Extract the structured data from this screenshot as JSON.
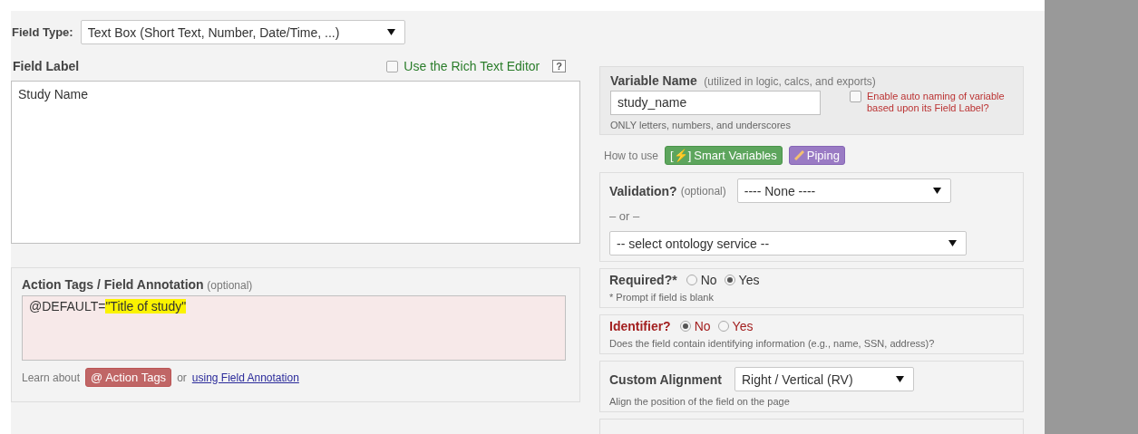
{
  "field_type": {
    "label": "Field Type:",
    "value": "Text Box (Short Text, Number, Date/Time, ...)"
  },
  "field_label": {
    "label": "Field Label",
    "rich_text": {
      "label": "Use the Rich Text Editor",
      "checked": false
    },
    "help": "?",
    "value": "Study Name"
  },
  "annotation": {
    "label": "Action Tags / Field Annotation",
    "hint": "(optional)",
    "value": "@DEFAULT=",
    "highlighted": "\"Title of study\"",
    "learn": "Learn about",
    "tags_button": "@ Action Tags",
    "or": "or",
    "link": "using Field Annotation"
  },
  "variable": {
    "label": "Variable Name",
    "hint": "(utilized in logic, calcs, and exports)",
    "value": "study_name",
    "note": "ONLY letters, numbers, and underscores",
    "auto_naming": {
      "label": "Enable auto naming of variable based upon its Field Label?",
      "checked": false
    }
  },
  "how_to_use": {
    "label": "How to use",
    "buttons": [
      {
        "kind": "smart",
        "icon": "[⚡]",
        "label": "Smart Variables"
      },
      {
        "kind": "piping",
        "label": "Piping"
      }
    ]
  },
  "validation": {
    "label": "Validation?",
    "hint": "(optional)",
    "value": "---- None ----",
    "or": "– or –",
    "ontology": "-- select ontology service --"
  },
  "required": {
    "label": "Required?*",
    "options": [
      {
        "label": "No",
        "selected": false
      },
      {
        "label": "Yes",
        "selected": true
      }
    ],
    "note": "* Prompt if field is blank"
  },
  "identifier": {
    "label": "Identifier?",
    "options": [
      {
        "label": "No",
        "selected": true
      },
      {
        "label": "Yes",
        "selected": false
      }
    ],
    "note": "Does the field contain identifying information (e.g., name, SSN, address)?"
  },
  "alignment": {
    "label": "Custom Alignment",
    "value": "Right / Vertical (RV)",
    "note": "Align the position of the field on the page"
  }
}
